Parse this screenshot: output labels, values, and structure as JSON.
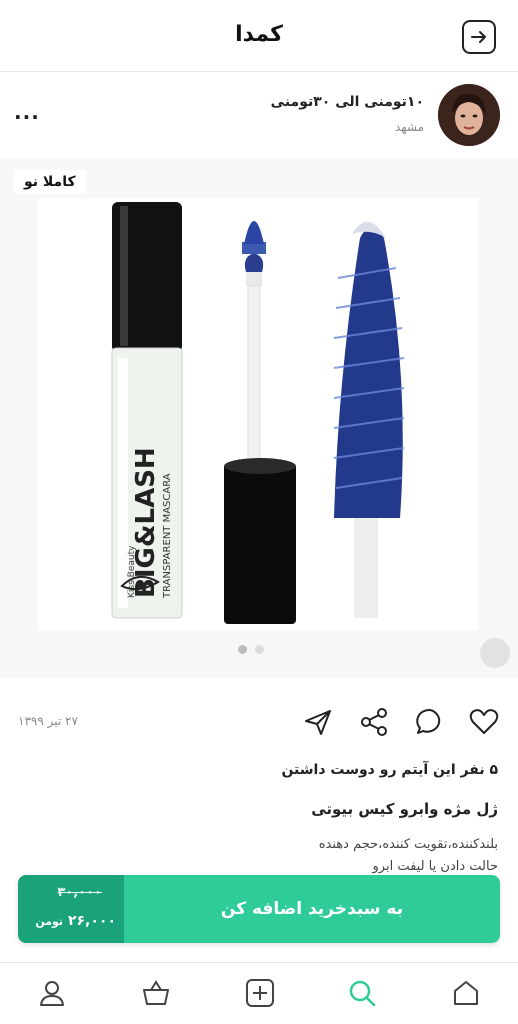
{
  "header": {
    "title": "کمدا",
    "back_icon": "arrow-right-box-icon"
  },
  "seller": {
    "name": "۱۰تومنی الی ۳۰تومنی",
    "city": "مشهد",
    "more_label": "..."
  },
  "photo": {
    "badge": "کاملا نو",
    "slide_count": 2,
    "active_slide": 1
  },
  "actions": {
    "date": "۲۷ تیر ۱۳۹۹",
    "icons": [
      "heart-icon",
      "comment-icon",
      "share-icon",
      "send-icon"
    ]
  },
  "item": {
    "likes": "۵ نفر این آیتم رو دوست داشتن",
    "title": "ژل مژه وابرو کیس بیوتی",
    "description_line1": "بلندکننده،تقویت کننده،حجم دهنده",
    "description_line2": "حالت دادن یا لیفت ابرو"
  },
  "cart": {
    "old_price": "۳۰,۰۰۰",
    "new_price": "۲۶,۰۰۰",
    "currency": "تومن",
    "button_label": "به سبدخرید اضافه کن"
  },
  "tabbar": {
    "items": [
      "home-icon",
      "search-icon",
      "add-icon",
      "basket-icon",
      "profile-icon"
    ],
    "active": "search-icon"
  },
  "colors": {
    "accent": "#2fcc9a",
    "accent_dark": "#1aa37a",
    "mascara_blue": "#2a3d8f"
  }
}
